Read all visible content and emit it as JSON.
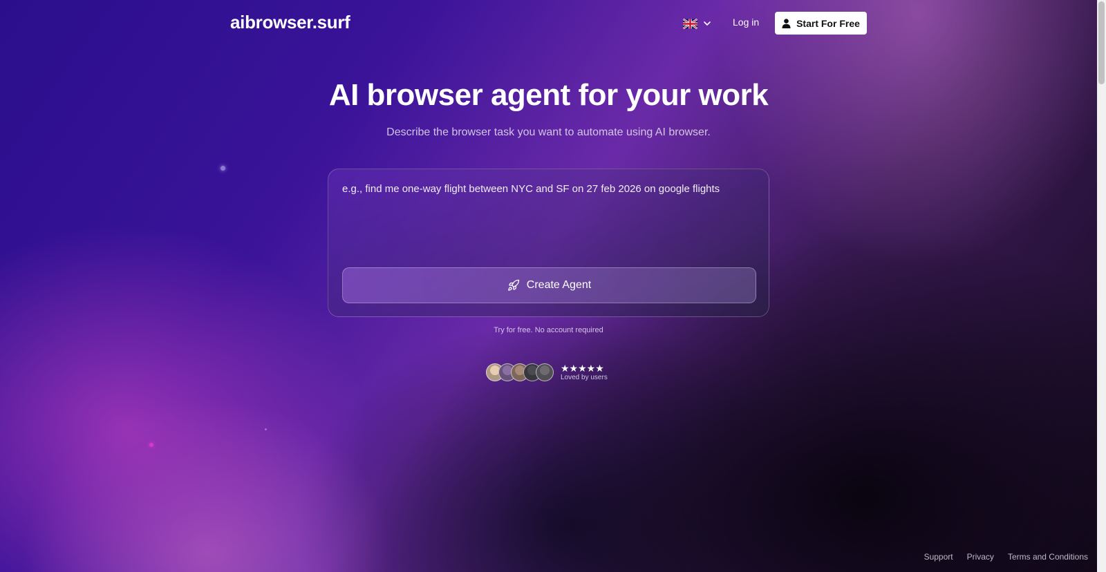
{
  "colors": {
    "accent": "#6a2aa8",
    "background_top_left": "#2a0f8c",
    "background_bottom_right": "#150a1e",
    "button_white": "#ffffff"
  },
  "header": {
    "logo": "aibrowser.surf",
    "language_icon": "uk-flag-icon",
    "language_dropdown_icon": "chevron-down-icon",
    "login_label": "Log in",
    "start_icon": "user-icon",
    "start_label": "Start For Free"
  },
  "hero": {
    "title": "AI browser agent for your work",
    "subtitle": "Describe the browser task you want to automate using AI browser."
  },
  "task_form": {
    "placeholder": "e.g., find me one-way flight between NYC and SF on 27 feb 2026 on google flights",
    "value": "",
    "submit_icon": "rocket-icon",
    "submit_label": "Create Agent"
  },
  "note": "Try for free. No account required",
  "social_proof": {
    "avatars": [
      {
        "name": "user-avatar-1",
        "color": "#e8cdb0"
      },
      {
        "name": "user-avatar-2",
        "color": "#8a6fa0"
      },
      {
        "name": "user-avatar-3",
        "color": "#a88a78"
      },
      {
        "name": "user-avatar-4",
        "color": "#4a4a52"
      },
      {
        "name": "user-avatar-5",
        "color": "#6e6a70"
      }
    ],
    "stars": "★★★★★",
    "rating_count": 5,
    "caption": "Loved by users"
  },
  "footer": {
    "links": [
      "Support",
      "Privacy",
      "Terms and Conditions"
    ]
  }
}
